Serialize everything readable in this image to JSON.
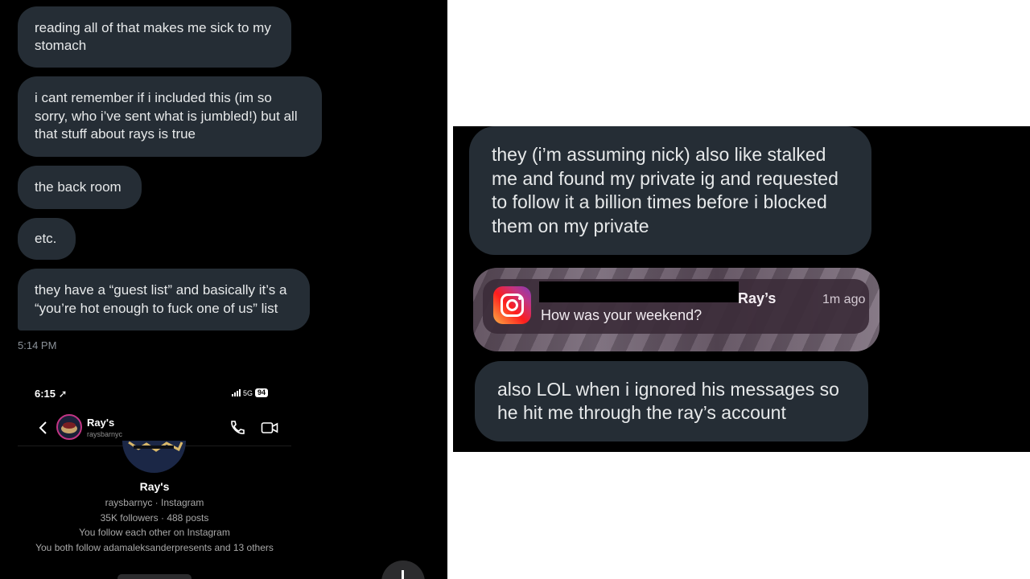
{
  "chat": {
    "messages": [
      "reading all of that makes me sick to my stomach",
      "i cant remember if i included this (im so sorry, who i’ve sent what is jumbled!) but all that stuff about rays is true",
      "the back room",
      "etc.",
      "they have a “guest list” and basically it’s a “you’re hot enough to fuck one of us” list"
    ],
    "timestamp": "5:14 PM"
  },
  "phone": {
    "time": "6:15",
    "network": "5G",
    "battery": "94",
    "contact_name": "Ray's",
    "contact_username": "raysbarnyc",
    "profile": {
      "name": "Ray's",
      "username_line": "raysbarnyc · Instagram",
      "stats": "35K followers · 488 posts",
      "follow_status": "You follow each other on Instagram",
      "mutuals": "You both follow adamaleksanderpresents and 13 others"
    }
  },
  "right": {
    "messages": [
      "they (i’m assuming nick) also like stalked me and found my private ig and requested to follow it a billion times before i blocked them on my private",
      "also LOL when i ignored his messages so he hit me through the ray’s account"
    ],
    "notification": {
      "app_icon": "instagram-icon",
      "title": "Ray’s",
      "time": "1m ago",
      "body": "How was your weekend?"
    }
  },
  "colors": {
    "bubble": "#252d35",
    "background": "#000000",
    "text": "#e7e9ea"
  }
}
